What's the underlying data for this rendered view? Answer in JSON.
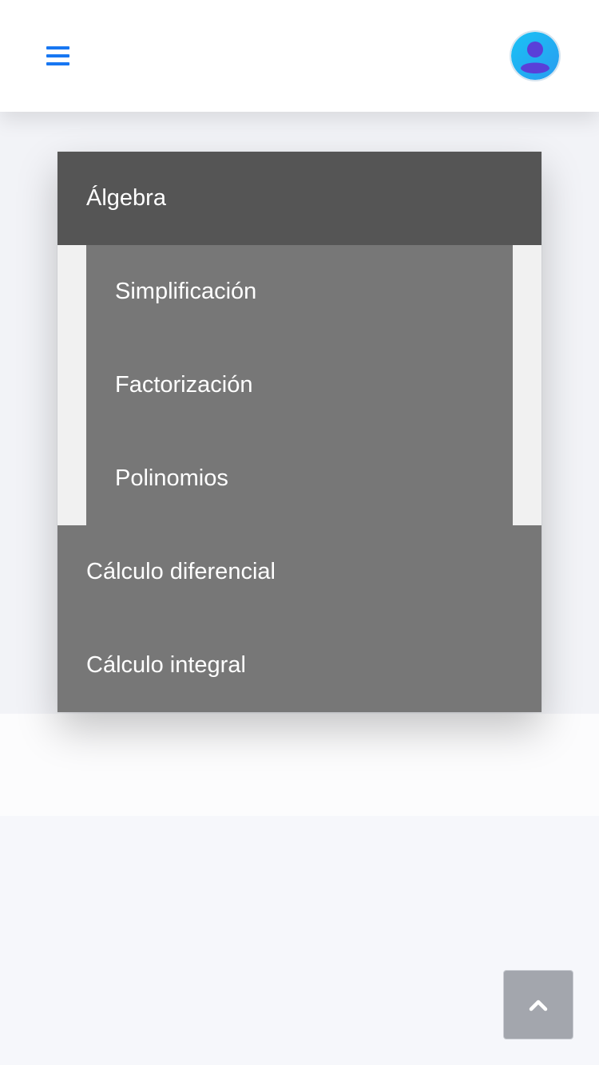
{
  "header": {
    "menu_icon": "hamburger-menu-icon",
    "avatar_icon": "user-avatar-icon",
    "accent_color": "#1877f2"
  },
  "menu": {
    "items": [
      {
        "label": "Álgebra",
        "expanded": true,
        "subitems": [
          {
            "label": "Simplificación"
          },
          {
            "label": "Factorización"
          },
          {
            "label": "Polinomios"
          }
        ]
      },
      {
        "label": "Cálculo diferencial"
      },
      {
        "label": "Cálculo integral"
      }
    ],
    "active_color": "#555555",
    "item_color": "#777777"
  },
  "scroll_top": {
    "icon": "chevron-up-icon"
  }
}
